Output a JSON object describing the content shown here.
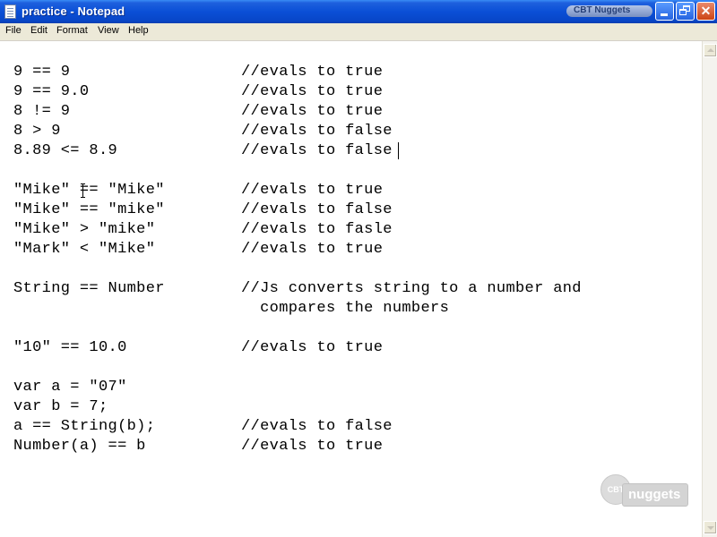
{
  "window": {
    "title": "practice - Notepad",
    "watermark_logo": "CBT Nuggets"
  },
  "menu": {
    "items": [
      "File",
      "Edit",
      "Format",
      "View",
      "Help"
    ]
  },
  "editor": {
    "lines": [
      {
        "code": "9 == 9",
        "comment": "//evals to true"
      },
      {
        "code": "9 == 9.0",
        "comment": "//evals to true"
      },
      {
        "code": "8 != 9",
        "comment": "//evals to true"
      },
      {
        "code": "8 > 9",
        "comment": "//evals to false"
      },
      {
        "code": "8.89 <= 8.9",
        "comment": "//evals to false"
      },
      {
        "code": "",
        "comment": ""
      },
      {
        "code": "\"Mike\" == \"Mike\"",
        "comment": "//evals to true"
      },
      {
        "code": "\"Mike\" == \"mike\"",
        "comment": "//evals to false"
      },
      {
        "code": "\"Mike\" > \"mike\"",
        "comment": "//evals to fasle"
      },
      {
        "code": "\"Mark\" < \"Mike\"",
        "comment": "//evals to true"
      },
      {
        "code": "",
        "comment": ""
      },
      {
        "code": "String == Number",
        "comment": "//Js converts string to a number and"
      },
      {
        "code": "",
        "comment": "  compares the numbers"
      },
      {
        "code": "",
        "comment": ""
      },
      {
        "code": "\"10\" == 10.0",
        "comment": "//evals to true"
      },
      {
        "code": "",
        "comment": ""
      },
      {
        "code": "var a = \"07\"",
        "comment": ""
      },
      {
        "code": "var b = 7;",
        "comment": ""
      },
      {
        "code": "a == String(b);",
        "comment": "//evals to false"
      },
      {
        "code": "Number(a) == b",
        "comment": "//evals to true"
      }
    ]
  },
  "watermark": {
    "circle_text": "CBT",
    "pill_text": "nuggets"
  }
}
